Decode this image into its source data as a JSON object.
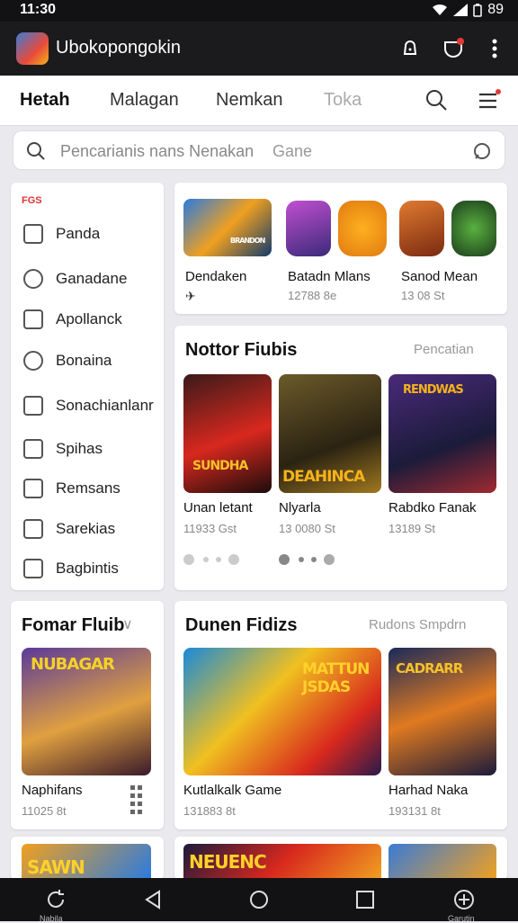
{
  "status": {
    "time": "11:30",
    "battery": "89"
  },
  "app": {
    "title": "Ubokopongokin"
  },
  "tabs": [
    {
      "label": "Hetah"
    },
    {
      "label": "Malagan"
    },
    {
      "label": "Nemkan"
    },
    {
      "label": "Toka"
    }
  ],
  "search": {
    "placeholder": "Pencarianis nans Nenakan",
    "scope": "Gane"
  },
  "sidebar": {
    "header": "FGS",
    "items": [
      {
        "label": "Panda"
      },
      {
        "label": "Ganadane"
      },
      {
        "label": "Apollanck"
      },
      {
        "label": "Bonaina"
      },
      {
        "label": "Sonachianlanr"
      },
      {
        "label": "Spihas"
      },
      {
        "label": "Remsans"
      },
      {
        "label": "Sarekias"
      },
      {
        "label": "Bagbintis"
      }
    ]
  },
  "featured": [
    {
      "name": "Dendaken",
      "meta": "",
      "art": "BRANDON"
    },
    {
      "name": "Batadn Mlans",
      "meta": "12788 8e"
    },
    {
      "name": "Sanod Mean",
      "meta": "13 08 St"
    }
  ],
  "popular": {
    "title": "Nottor Fiubis",
    "action": "Pencatian",
    "games": [
      {
        "name": "Unan letant",
        "meta": "11933 Gst",
        "art": "SUNDHA"
      },
      {
        "name": "Nlyarla",
        "meta": "13 0080 St",
        "art": "DEAHINCA"
      },
      {
        "name": "Rabdko Fanak",
        "meta": "13189 St",
        "art": "RENDWAS"
      }
    ]
  },
  "left_section": {
    "title": "Fomar Fluib",
    "game": {
      "name": "Naphifans",
      "meta": "11025 8t",
      "art": "NUBAGAR"
    }
  },
  "right_section": {
    "title": "Dunen Fidizs",
    "action": "Rudons Smpdrn",
    "games": [
      {
        "name": "Kutlalkalk Game",
        "meta": "131883 8t",
        "art": "MATTUN JSDAS"
      },
      {
        "name": "Harhad Naka",
        "meta": "193131 8t",
        "art": "CADRARR"
      }
    ]
  },
  "bottom_row": {
    "art1": "SAWN",
    "art2": "NEUENC"
  },
  "nav": {
    "left_label": "Nabila",
    "right_label": "Garutin"
  }
}
